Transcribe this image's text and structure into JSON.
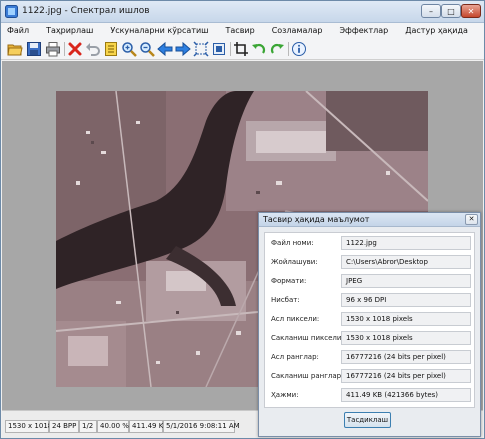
{
  "window": {
    "title": "1122.jpg - Спектрал ишлов",
    "controls": {
      "minimize": "–",
      "maximize": "□",
      "close": "✕"
    }
  },
  "menu": {
    "items": [
      "Файл",
      "Таҳрирлаш",
      "Ускуналарни кўрсатиш",
      "Тасвир",
      "Созламалар",
      "Эффектлар",
      "Дастур ҳақида"
    ]
  },
  "toolbar": {
    "icons": [
      "open-folder-icon",
      "save-disk-icon",
      "print-icon",
      "delete-icon",
      "undo-icon",
      "document-icon",
      "zoom-in-icon",
      "zoom-out-icon",
      "arrow-left-icon",
      "arrow-right-icon",
      "fit-icon",
      "actual-size-icon",
      "crop-icon",
      "rotate-left-icon",
      "rotate-right-icon",
      "info-icon"
    ]
  },
  "statusbar": {
    "dimensions": "1530 x 1018",
    "bpp": "24 BPP",
    "page": "1/2",
    "zoom": "40.00 %",
    "filesize": "411.49 KB",
    "datetime": "5/1/2016 9:08:11 AM"
  },
  "dialog": {
    "title": "Тасвир ҳақида маълумот",
    "close": "✕",
    "rows": [
      {
        "label": "Файл номи:",
        "value": "1122.jpg"
      },
      {
        "label": "Жойлашуви:",
        "value": "C:\\Users\\Abror\\Desktop"
      },
      {
        "label": "Формати:",
        "value": "JPEG"
      },
      {
        "label": "Нисбат:",
        "value": "96 x 96 DPI"
      },
      {
        "label": "Асл пиксели:",
        "value": "1530 x 1018 pixels"
      },
      {
        "label": "Сакланиш пиксели:",
        "value": "1530 x 1018 pixels"
      },
      {
        "label": "Асл ранглар:",
        "value": "16777216 (24 bits per pixel)"
      },
      {
        "label": "Сакланиш ранглар:",
        "value": "16777216 (24 bits per pixel)"
      },
      {
        "label": "Ҳажми:",
        "value": "411.49 KB (421366 bytes)"
      }
    ],
    "ok_label": "Тасдиклаш"
  },
  "colors": {
    "photo_base": "#8a6e73",
    "water": "#2f2326",
    "window_frame": "#6d8aa8",
    "canvas_bg": "#a7a7a7"
  }
}
